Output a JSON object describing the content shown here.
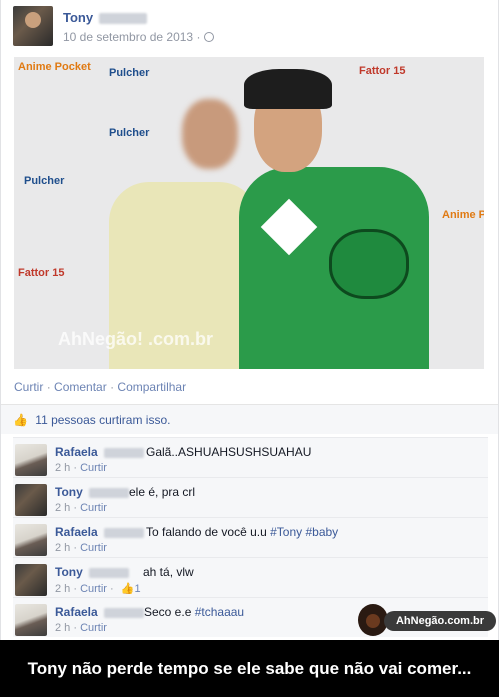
{
  "post": {
    "author_name": "Tony",
    "date": "10 de setembro de 2013",
    "date_sep": "·",
    "photo": {
      "backdrop_logos": [
        "Pulcher",
        "Fattor 15",
        "Anime Pocket"
      ],
      "watermark": "AhNegão! .com.br"
    },
    "actions": {
      "like": "Curtir",
      "comment": "Comentar",
      "share": "Compartilhar",
      "sep": "·"
    },
    "likes": {
      "icon": "thumbs-up-icon",
      "text": "11 pessoas curtiram isso."
    }
  },
  "comments": [
    {
      "author": "Rafaela",
      "text": "Galã..ASHUAHSUSHSUAHAU",
      "time": "2 h",
      "like": "Curtir",
      "likes_count": ""
    },
    {
      "author": "Tony",
      "text": "ele é, pra crl",
      "time": "2 h",
      "like": "Curtir",
      "likes_count": ""
    },
    {
      "author": "Rafaela",
      "text_plain": "To falando de você u.u",
      "tag1": "#Tony",
      "tag2": "#baby",
      "time": "2 h",
      "like": "Curtir",
      "likes_count": ""
    },
    {
      "author": "Tony",
      "text": "ah tá, vlw",
      "time": "2 h",
      "like": "Curtir",
      "likes_count": "1"
    },
    {
      "author": "Rafaela",
      "text_plain": "Seco e.e",
      "tag1": "#tchaaau",
      "time": "2 h",
      "like": "Curtir",
      "likes_count": ""
    }
  ],
  "badge": {
    "text": "AhNegão.com.br"
  },
  "caption": "Tony não perde tempo se ele sabe que não vai comer...",
  "colors": {
    "link": "#3b5998",
    "meta": "#9197a3",
    "caption_bg": "#000000"
  }
}
